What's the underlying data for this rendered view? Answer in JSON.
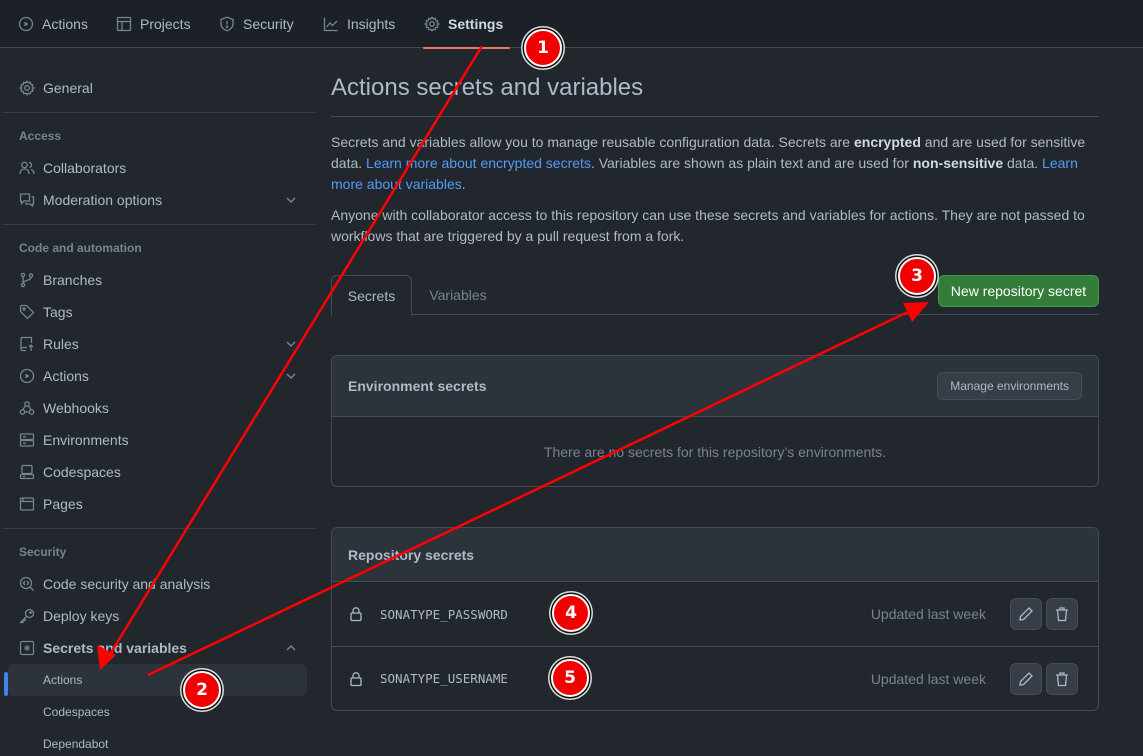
{
  "topnav": {
    "tabs": [
      {
        "label": "Actions",
        "icon": "play-icon"
      },
      {
        "label": "Projects",
        "icon": "table-icon"
      },
      {
        "label": "Security",
        "icon": "shield-icon"
      },
      {
        "label": "Insights",
        "icon": "graph-icon"
      },
      {
        "label": "Settings",
        "icon": "gear-icon",
        "active": true
      }
    ]
  },
  "sidebar": {
    "general": "General",
    "sections": {
      "access": "Access",
      "code_automation": "Code and automation",
      "security": "Security"
    },
    "items": {
      "collaborators": "Collaborators",
      "moderation": "Moderation options",
      "branches": "Branches",
      "tags": "Tags",
      "rules": "Rules",
      "actions": "Actions",
      "webhooks": "Webhooks",
      "environments": "Environments",
      "codespaces": "Codespaces",
      "pages": "Pages",
      "code_security": "Code security and analysis",
      "deploy_keys": "Deploy keys",
      "secrets_variables": "Secrets and variables"
    },
    "sub_items": {
      "actions": "Actions",
      "codespaces": "Codespaces",
      "dependabot": "Dependabot"
    }
  },
  "main": {
    "title": "Actions secrets and variables",
    "desc1": {
      "p1": "Secrets and variables allow you to manage reusable configuration data. Secrets are ",
      "b1": "encrypted",
      "p2": " and are used for sensitive data. ",
      "link1": "Learn more about encrypted secrets",
      "p3": ". Variables are shown as plain text and are used for ",
      "b2": "non-sensitive",
      "p4": " data. ",
      "link2": "Learn more about variables",
      "p5": "."
    },
    "desc2": "Anyone with collaborator access to this repository can use these secrets and variables for actions. They are not passed to workflows that are triggered by a pull request from a fork.",
    "tabs": {
      "secrets": "Secrets",
      "variables": "Variables"
    },
    "new_secret_button": "New repository secret",
    "env_secrets": {
      "title": "Environment secrets",
      "manage_button": "Manage environments",
      "empty": "There are no secrets for this repository’s environments."
    },
    "repo_secrets": {
      "title": "Repository secrets",
      "rows": [
        {
          "name": "SONATYPE_PASSWORD",
          "updated": "Updated last week"
        },
        {
          "name": "SONATYPE_USERNAME",
          "updated": "Updated last week"
        }
      ]
    }
  },
  "annotations": {
    "color": "#ff0000",
    "badges": [
      "1",
      "2",
      "3",
      "4",
      "5"
    ]
  }
}
